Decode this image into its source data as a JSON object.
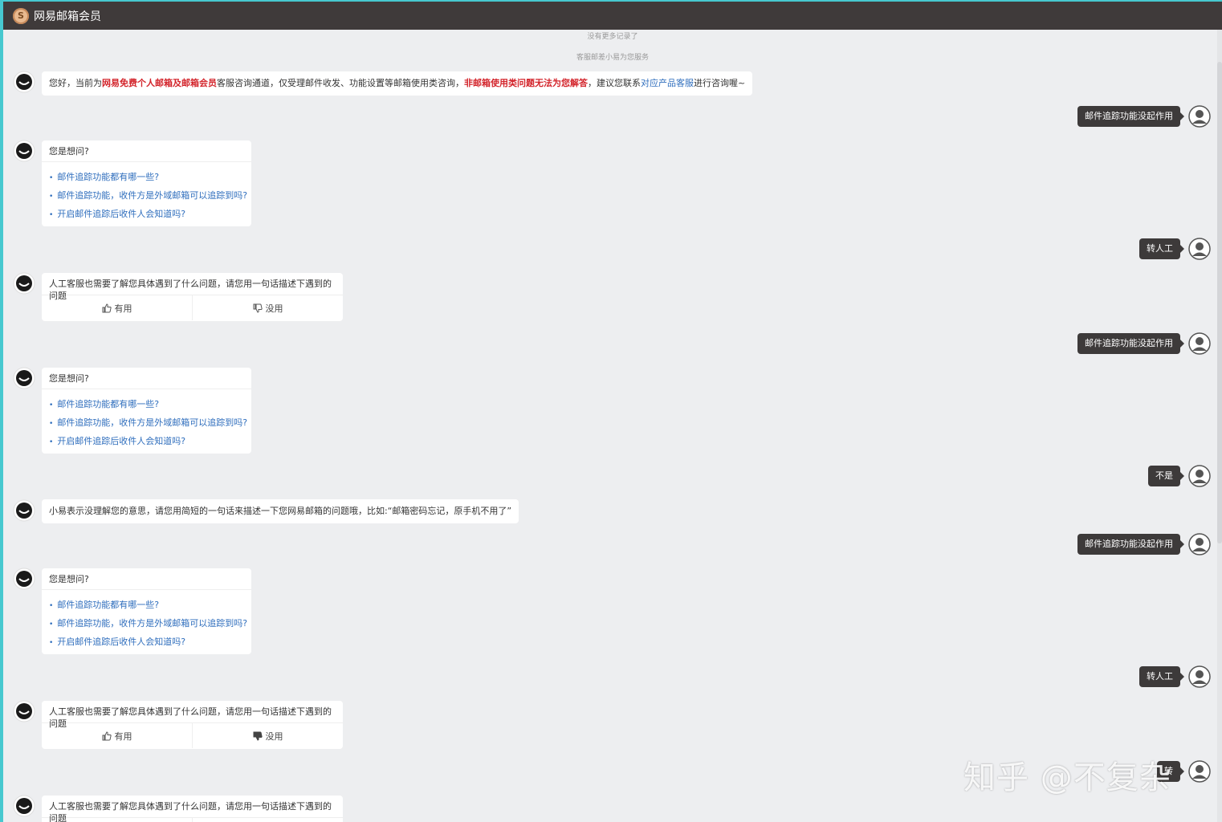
{
  "app": {
    "title": "网易邮箱会员"
  },
  "system": {
    "no_more": "没有更多记录了",
    "service_notice": "客服邮差小易为您服务"
  },
  "welcome": {
    "p1": "您好，当前为",
    "hl1": "网易免费个人邮箱及邮箱会员",
    "p2": "客服咨询通道，仅受理邮件收发、功能设置等邮箱使用类咨询，",
    "hl2": "非邮箱使用类问题无法为您解答",
    "p3": "，建议您联系",
    "link": "对应产品客服",
    "p4": "进行咨询喔~"
  },
  "user_messages": {
    "tracking_not_working": "邮件追踪功能没起作用",
    "transfer_human": "转人工",
    "no": "不是",
    "partial": "转"
  },
  "suggest": {
    "header": "您是想问?",
    "items": [
      "邮件追踪功能都有哪一些?",
      "邮件追踪功能，收件方是外域邮箱可以追踪到吗?",
      "开启邮件追踪后收件人会知道吗?"
    ]
  },
  "human_prompt": "人工客服也需要了解您具体遇到了什么问题，请您用一句话描述下遇到的问题",
  "feedback": {
    "useful": "有用",
    "useless": "没用"
  },
  "not_understood": "小易表示没理解您的意思，请您用简短的一句话来描述一下您网易邮箱的问题哦，比如:“邮箱密码忘记，原手机不用了”",
  "watermark": "知乎 @不复杂",
  "colors": {
    "titlebar": "#3f3a3a",
    "background": "#edeef0",
    "user_bubble": "#3d3a3a",
    "link": "#2f6ebd",
    "highlight": "#d3242b"
  },
  "icons": {
    "bot_avatar": "bot-avatar-icon",
    "user_avatar": "user-avatar-icon",
    "thumbs_up": "thumbs-up-icon",
    "thumbs_down": "thumbs-down-icon"
  }
}
